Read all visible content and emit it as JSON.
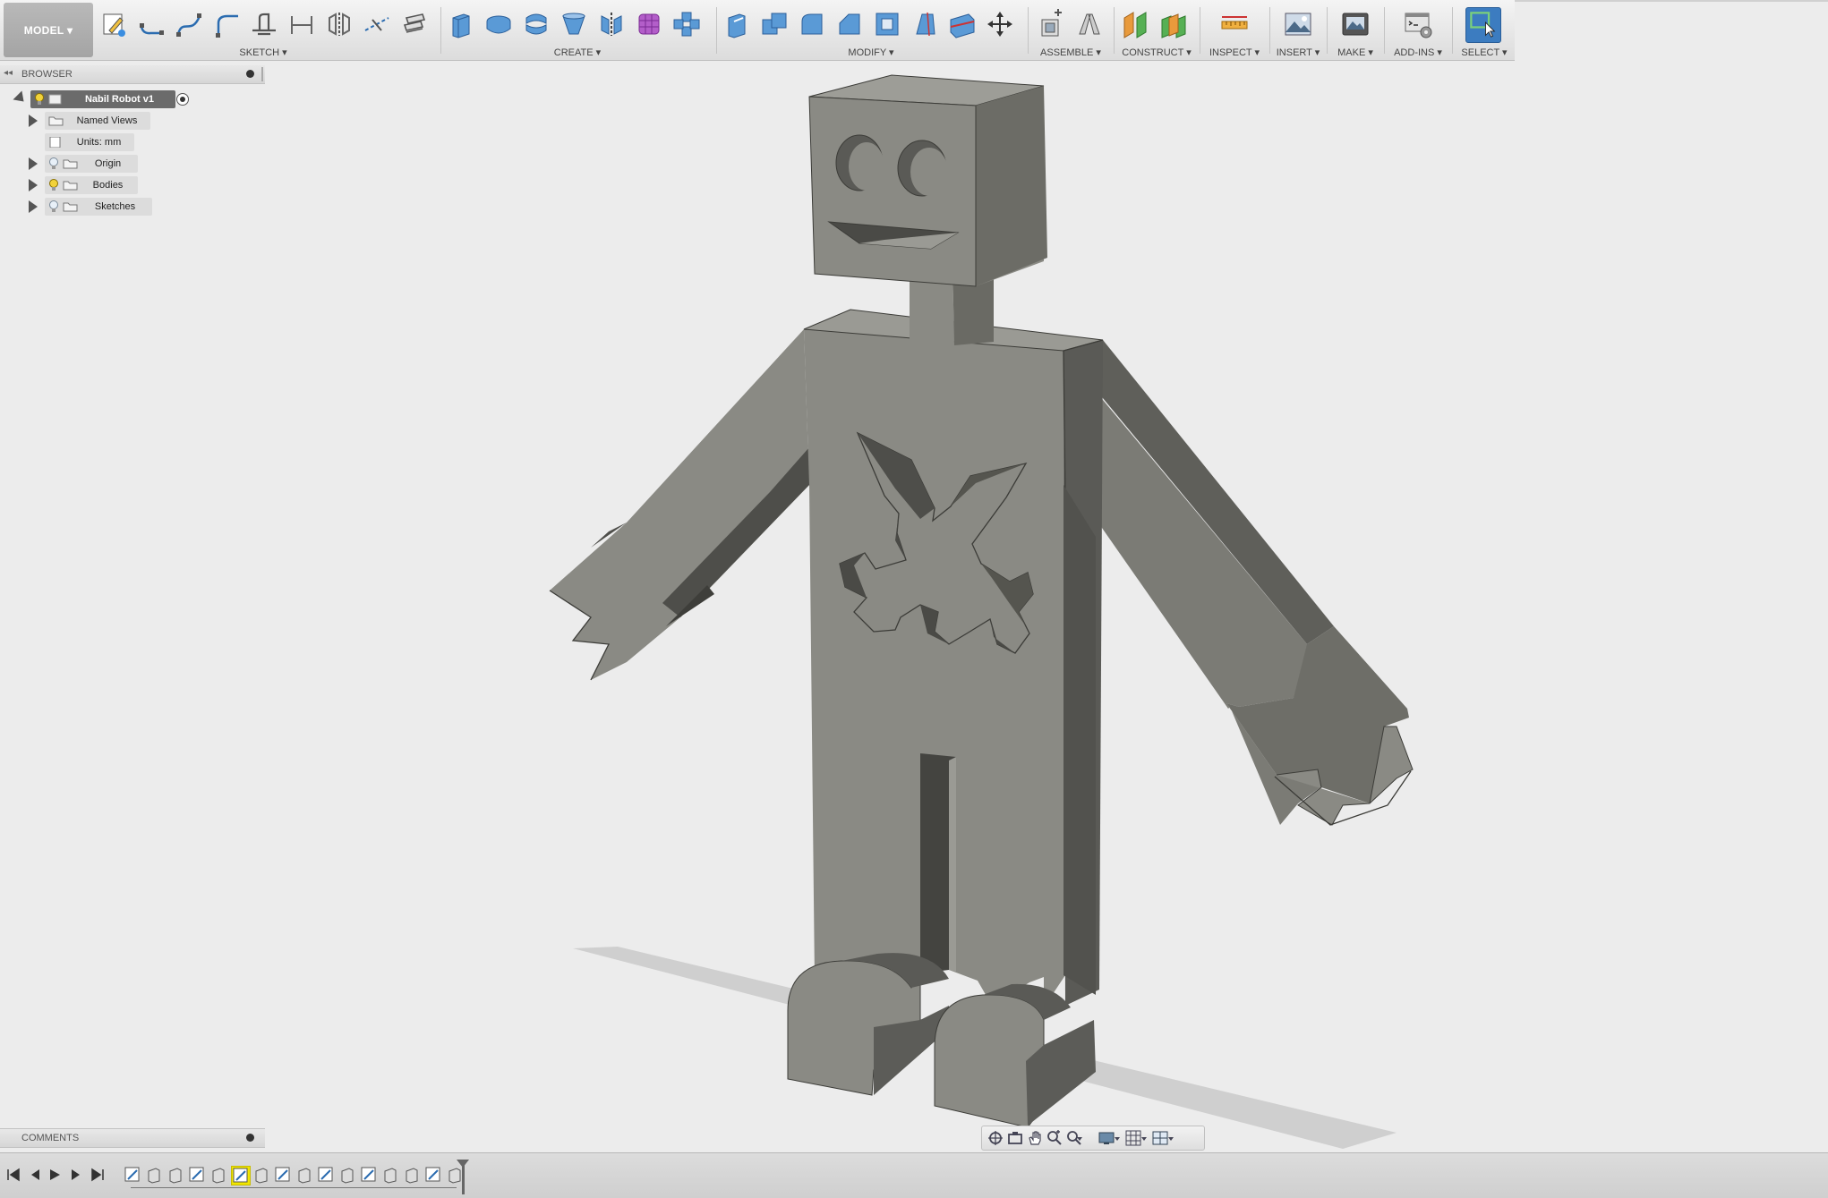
{
  "toolbar": {
    "workspace_label": "MODEL ▾",
    "groups": [
      {
        "label": "SKETCH ▾"
      },
      {
        "label": "CREATE ▾"
      },
      {
        "label": "MODIFY ▾"
      },
      {
        "label": "ASSEMBLE ▾"
      },
      {
        "label": "CONSTRUCT ▾"
      },
      {
        "label": "INSPECT ▾"
      },
      {
        "label": "INSERT ▾"
      },
      {
        "label": "MAKE ▾"
      },
      {
        "label": "ADD-INS ▾"
      },
      {
        "label": "SELECT ▾"
      }
    ]
  },
  "browser": {
    "title": "BROWSER",
    "root": "Nabil Robot v1",
    "items": [
      {
        "label": "Named Views"
      },
      {
        "label": "Units: mm"
      },
      {
        "label": "Origin"
      },
      {
        "label": "Bodies"
      },
      {
        "label": "Sketches"
      }
    ]
  },
  "comments": {
    "title": "COMMENTS"
  },
  "colors": {
    "select_accent": "#3c7cc0",
    "active_feature": "#f1e600",
    "model_body": "#8a8a84"
  },
  "icons": {
    "sketch": [
      "create-sketch-icon",
      "line-icon",
      "spline-icon",
      "fillet-sketch-icon",
      "trim-icon",
      "offset-icon",
      "mirror-icon",
      "project-icon",
      "stop-sketch-icon"
    ],
    "create": [
      "extrude-icon",
      "revolve-icon",
      "sweep-icon",
      "loft-icon",
      "mirror-body-icon",
      "form-icon",
      "pattern-icon"
    ],
    "modify": [
      "press-pull-icon",
      "combine-icon",
      "fillet-icon",
      "chamfer-icon",
      "shell-icon",
      "draft-icon",
      "split-face-icon",
      "move-icon"
    ],
    "assemble": [
      "new-component-icon",
      "joint-icon"
    ],
    "construct": [
      "offset-plane-icon",
      "midplane-icon"
    ],
    "inspect": [
      "measure-icon"
    ],
    "insert": [
      "insert-image-icon"
    ],
    "make": [
      "3d-print-icon"
    ],
    "addins": [
      "scripts-icon"
    ],
    "select": [
      "select-icon"
    ]
  },
  "timeline": {
    "active_feature_index": 5,
    "feature_count": 16
  }
}
